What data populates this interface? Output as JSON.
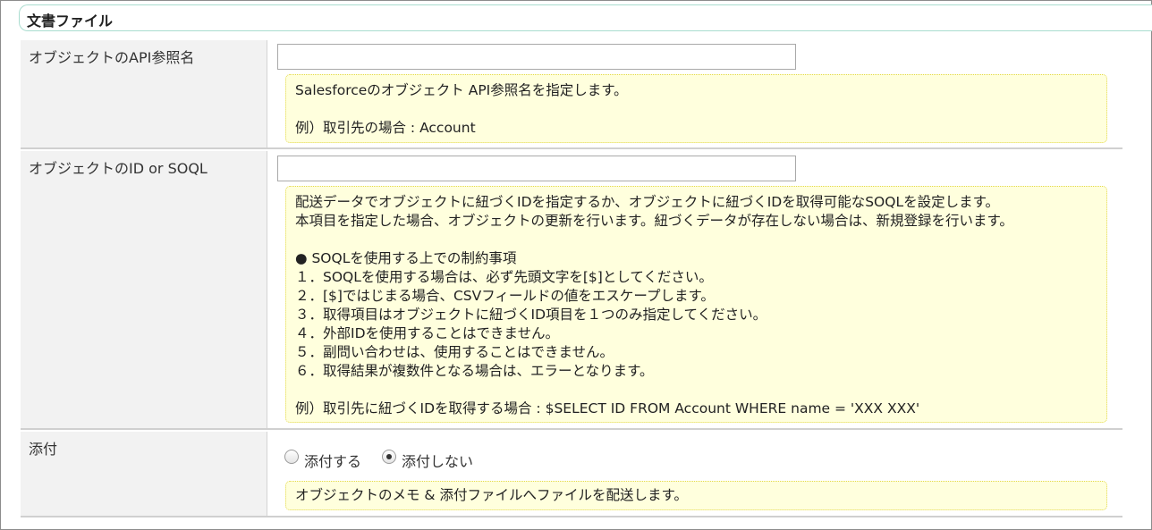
{
  "section": {
    "title": "文書ファイル"
  },
  "fields": {
    "api_name": {
      "label": "オブジェクトのAPI参照名",
      "value": "",
      "help_lines": [
        "Salesforceのオブジェクト API参照名を指定します。",
        "",
        "例）取引先の場合 : Account"
      ]
    },
    "id_soql": {
      "label": "オブジェクトのID or SOQL",
      "value": "",
      "help_lines": [
        "配送データでオブジェクトに紐づくIDを指定するか、オブジェクトに紐づくIDを取得可能なSOQLを設定します。",
        "本項目を指定した場合、オブジェクトの更新を行います。紐づくデータが存在しない場合は、新規登録を行います。",
        "",
        "● SOQLを使用する上での制約事項",
        "１．SOQLを使用する場合は、必ず先頭文字を[$]としてください。",
        "２．[$]ではじまる場合、CSVフィールドの値をエスケープします。",
        "３．取得項目はオブジェクトに紐づくID項目を１つのみ指定してください。",
        "４．外部IDを使用することはできません。",
        "５．副問い合わせは、使用することはできません。",
        "６．取得結果が複数件となる場合は、エラーとなります。",
        "",
        "例）取引先に紐づくIDを取得する場合 : $SELECT ID FROM Account WHERE name = 'XXX XXX'"
      ]
    },
    "attach": {
      "label": "添付",
      "options": [
        {
          "label": "添付する",
          "selected": false
        },
        {
          "label": "添付しない",
          "selected": true
        }
      ],
      "help_lines": [
        "オブジェクトのメモ & 添付ファイルへファイルを配送します。"
      ]
    }
  },
  "colors": {
    "label_bg": "#f2f2f2",
    "help_bg": "#ffffdd",
    "help_border": "#e3d94a",
    "header_border": "#a9dccf"
  }
}
